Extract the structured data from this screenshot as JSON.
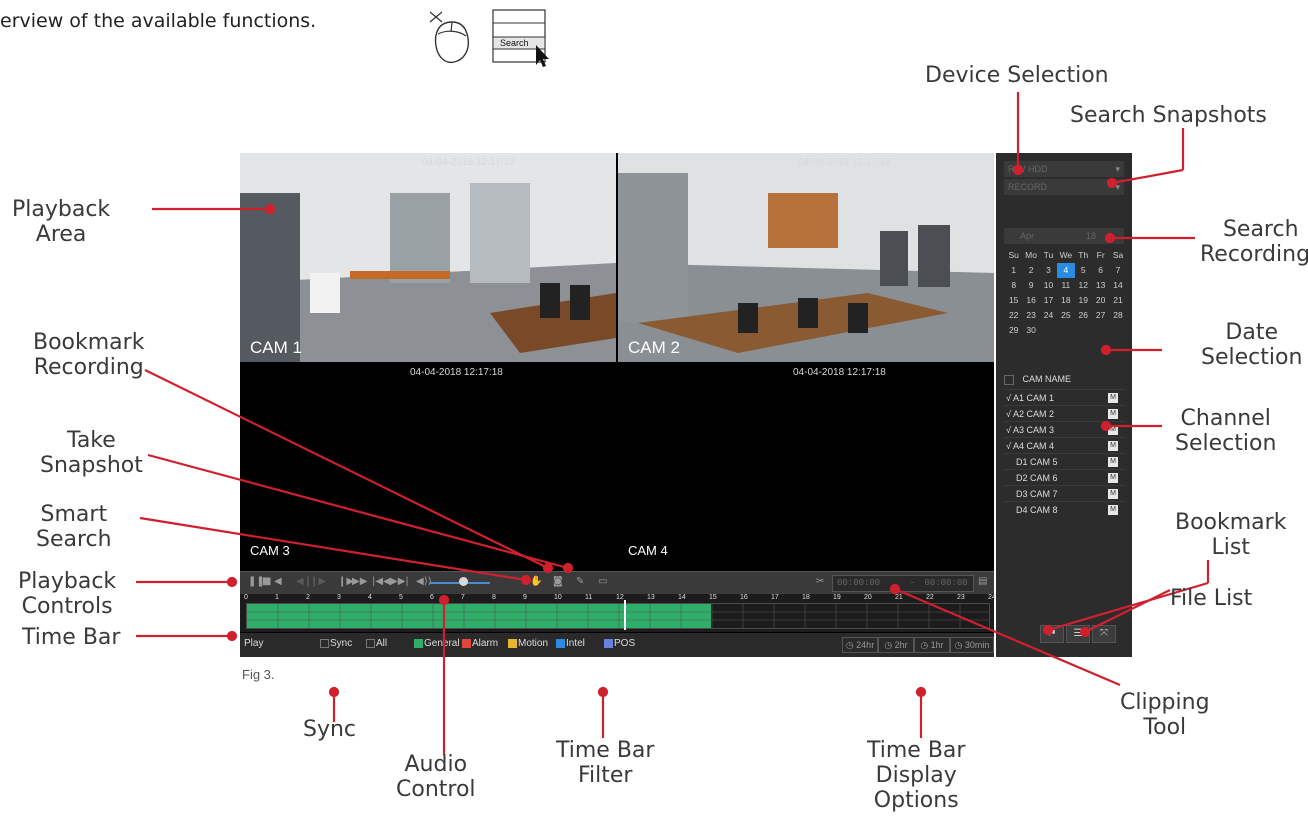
{
  "intro": "erview of the available functions.",
  "search_button": "Search",
  "figure_caption": "Fig 3.",
  "labels": {
    "device_selection": "Device Selection",
    "search_snapshots": "Search Snapshots",
    "playback_area": [
      "Playback",
      "Area"
    ],
    "search_recordings": [
      "Search",
      "Recordings"
    ],
    "bookmark_recording": [
      "Bookmark",
      "Recording"
    ],
    "date_selection": [
      "Date",
      "Selection"
    ],
    "take_snapshot": [
      "Take",
      "Snapshot"
    ],
    "channel_selection": [
      "Channel",
      "Selection"
    ],
    "smart_search": [
      "Smart",
      "Search"
    ],
    "bookmark_list": [
      "Bookmark",
      "List"
    ],
    "playback_controls": [
      "Playback",
      "Controls"
    ],
    "file_list": "File List",
    "time_bar": "Time Bar",
    "sync": "Sync",
    "time_bar_filter": [
      "Time Bar",
      "Filter"
    ],
    "time_bar_display_options": [
      "Time Bar",
      "Display",
      "Options"
    ],
    "clipping_tool": [
      "Clipping",
      "Tool"
    ],
    "audio_control": [
      "Audio",
      "Control"
    ]
  },
  "cameras": [
    {
      "name": "CAM 1",
      "timestamp": "04-04-2018 12:17:18"
    },
    {
      "name": "CAM 2",
      "timestamp": "04-04-2018 12:17:18"
    },
    {
      "name": "CAM 3",
      "timestamp": "04-04-2018 12:17:18"
    },
    {
      "name": "CAM 4",
      "timestamp": "04-04-2018 12:17:18"
    }
  ],
  "controls": {
    "clip_start": "00:00:00",
    "clip_sep": "-",
    "clip_end": "00:00:00",
    "volume_level": 0.55
  },
  "timebar": {
    "ticks": [
      "0",
      "1",
      "2",
      "3",
      "4",
      "5",
      "6",
      "7",
      "8",
      "9",
      "10",
      "11",
      "12",
      "13",
      "14",
      "15",
      "16",
      "17",
      "18",
      "19",
      "20",
      "21",
      "22",
      "23",
      "24"
    ],
    "recorded_until_hour": 15,
    "cursor_hour": 12.2
  },
  "bottombar": {
    "play": "Play",
    "sync": "Sync",
    "all": "All",
    "filters": [
      {
        "label": "General",
        "color": "#2fae6a"
      },
      {
        "label": "Alarm",
        "color": "#e0463a"
      },
      {
        "label": "Motion",
        "color": "#e6b82e"
      },
      {
        "label": "Intel",
        "color": "#2a8ce0"
      },
      {
        "label": "POS",
        "color": "#6a7fe0"
      }
    ],
    "ranges": [
      "24hr",
      "2hr",
      "1hr",
      "30min"
    ]
  },
  "panel": {
    "device": "R/W HDD",
    "record_type": "RECORD",
    "month": "Apr",
    "year": "18",
    "weekdays": [
      "Su",
      "Mo",
      "Tu",
      "We",
      "Th",
      "Fr",
      "Sa"
    ],
    "weeks": [
      [
        "1",
        "2",
        "3",
        "4",
        "5",
        "6",
        "7"
      ],
      [
        "8",
        "9",
        "10",
        "11",
        "12",
        "13",
        "14"
      ],
      [
        "15",
        "16",
        "17",
        "18",
        "19",
        "20",
        "21"
      ],
      [
        "22",
        "23",
        "24",
        "25",
        "26",
        "27",
        "28"
      ],
      [
        "29",
        "30",
        "",
        "",
        "",
        "",
        ""
      ]
    ],
    "selected_day": "4",
    "channel_header": "CAM NAME",
    "channels": [
      {
        "label": "√ A1 CAM 1"
      },
      {
        "label": "√ A2 CAM 2"
      },
      {
        "label": "√ A3 CAM 3"
      },
      {
        "label": "√ A4 CAM 4"
      },
      {
        "label": "D1 CAM 5"
      },
      {
        "label": "D2 CAM 6"
      },
      {
        "label": "D3 CAM 7"
      },
      {
        "label": "D4 CAM 8"
      }
    ],
    "m_badge": "M"
  },
  "colors": {
    "accent_red": "#d0202e",
    "timeline_green": "#2fae6a",
    "select_blue": "#2a8ce0"
  }
}
